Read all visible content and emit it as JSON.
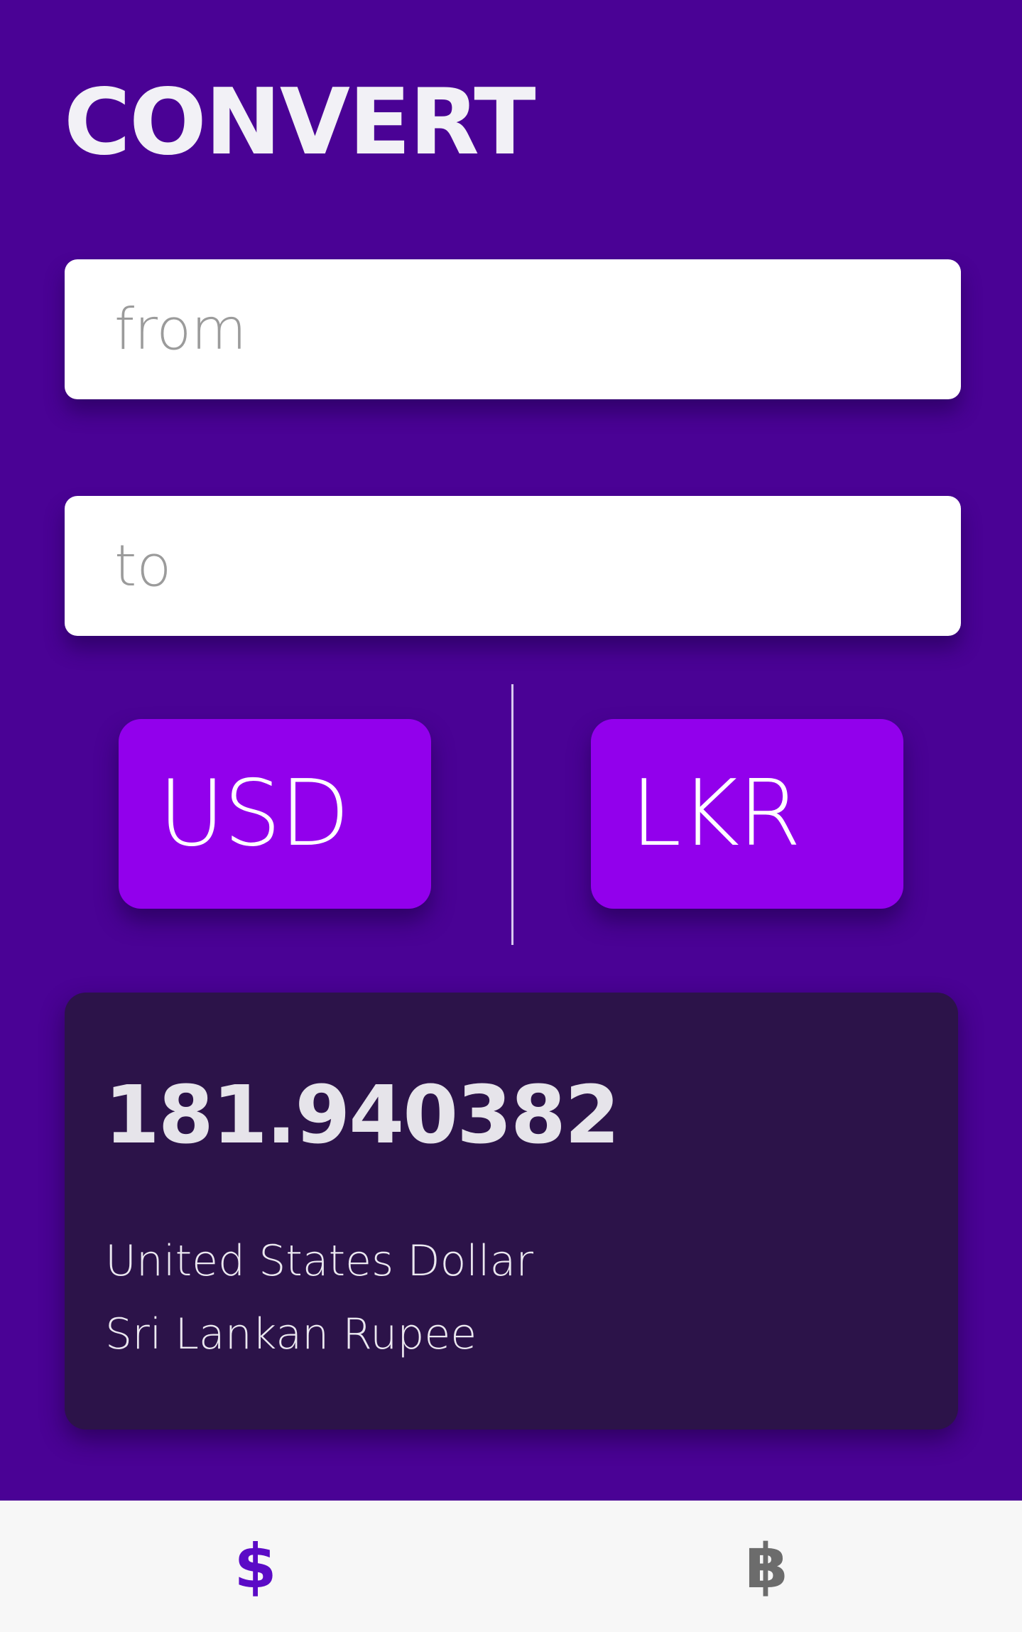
{
  "header": {
    "title": "CONVERT"
  },
  "inputs": {
    "from": {
      "placeholder": "from",
      "value": ""
    },
    "to": {
      "placeholder": "to",
      "value": ""
    }
  },
  "currencies": {
    "from_code": "USD",
    "to_code": "LKR"
  },
  "result": {
    "value": "181.940382",
    "from_name": "United States Dollar",
    "to_name": "Sri Lankan Rupee"
  },
  "bottom_nav": {
    "items": [
      {
        "icon": "dollar-icon",
        "glyph": "$",
        "active": true
      },
      {
        "icon": "bitcoin-icon",
        "glyph": "฿",
        "active": false
      }
    ]
  },
  "colors": {
    "background": "#4a0295",
    "currency_button": "#9200ec",
    "result_card": "#2c1349",
    "nav_active": "#5b0bc6",
    "nav_inactive": "#6c6c6c"
  }
}
